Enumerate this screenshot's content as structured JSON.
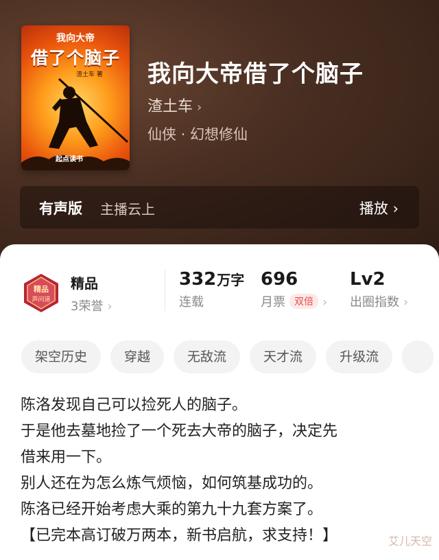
{
  "book": {
    "title": "我向大帝借了个脑子",
    "author": "渣土车",
    "genre": "仙侠 · 幻想修仙",
    "cover": {
      "title_small": "我向大帝",
      "title_big": "借了个脑子",
      "author_tag": "渣土车 著",
      "publisher": "起点读书"
    }
  },
  "audio": {
    "label": "有声版",
    "narrator": "主播云上",
    "play": "播放 ›"
  },
  "quality": {
    "label": "精品",
    "honors": "3荣誉",
    "badge_text": "精品 声问道"
  },
  "stats": [
    {
      "value": "332",
      "unit": "万字",
      "label": "连载"
    },
    {
      "value": "696",
      "unit": "",
      "label": "月票",
      "badge": "双倍"
    },
    {
      "value": "Lv2",
      "unit": "",
      "label": "出圈指数"
    }
  ],
  "tags": [
    "架空历史",
    "穿越",
    "无敌流",
    "天才流",
    "升级流"
  ],
  "description": [
    "陈洛发现自己可以捡死人的脑子。",
    "于是他去墓地捡了一个死去大帝的脑子，决定先",
    "借来用一下。",
    "别人还在为怎么炼气烦恼，如何筑基成功的。",
    "陈洛已经开始考虑大乘的第九十九套方案了。",
    "【已完本高订破万两本，新书启航，求支持！】"
  ],
  "watermark": "艾儿天空",
  "colors": {
    "hero_bg": "#3b2418",
    "accent_red": "#e94b4b"
  }
}
